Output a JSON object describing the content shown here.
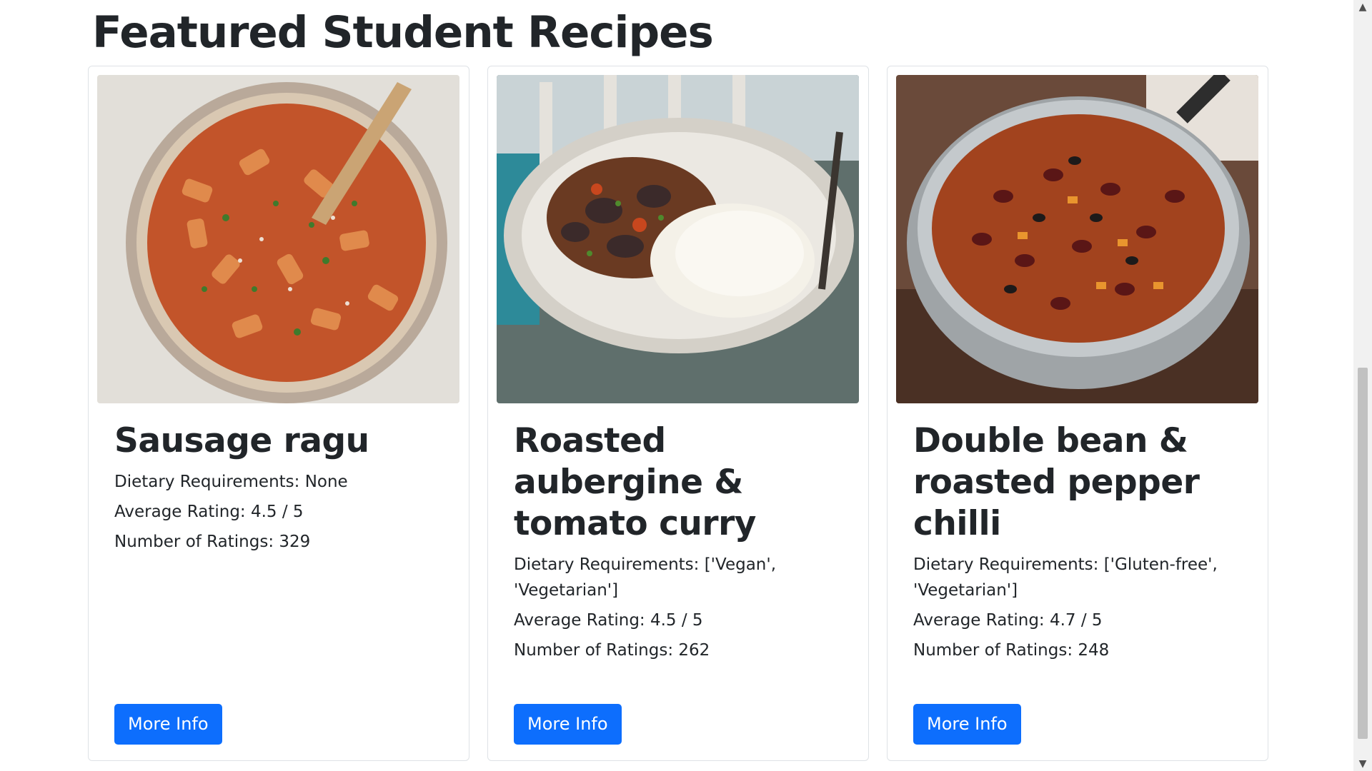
{
  "section": {
    "title": "Featured Student Recipes"
  },
  "cards": [
    {
      "title": "Sausage ragu",
      "dietary": "Dietary Requirements: None",
      "rating": "Average Rating: 4.5 / 5",
      "count": "Number of Ratings: 329",
      "button": "More Info",
      "image_icon": "sausage-ragu-photo"
    },
    {
      "title": "Roasted aubergine & tomato curry",
      "dietary": "Dietary Requirements: ['Vegan', 'Vegetarian']",
      "rating": "Average Rating: 4.5 / 5",
      "count": "Number of Ratings: 262",
      "button": "More Info",
      "image_icon": "aubergine-curry-photo"
    },
    {
      "title": "Double bean & roasted pepper chilli",
      "dietary": "Dietary Requirements: ['Gluten-free', 'Vegetarian']",
      "rating": "Average Rating: 4.7 / 5",
      "count": "Number of Ratings: 248",
      "button": "More Info",
      "image_icon": "bean-chilli-photo"
    }
  ],
  "colors": {
    "primary_button": "#0d6efd",
    "card_border": "#dee2e6",
    "text": "#212529"
  }
}
